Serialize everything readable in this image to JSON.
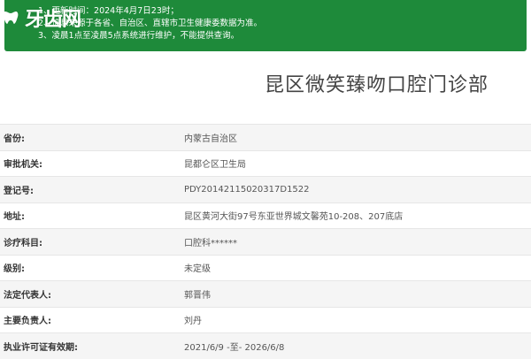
{
  "logo": {
    "text": "牙齿网"
  },
  "notice": {
    "lines": [
      "1、更新时间：2024年4月7日23时；",
      "2、信息来源于各省、自治区、直辖市卫生健康委数据为准。",
      "3、凌晨1点至凌晨5点系统进行维护，不能提供查询。"
    ]
  },
  "title": "昆区微笑臻吻口腔门诊部",
  "rows": [
    {
      "label": "省份:",
      "value": "内蒙古自治区"
    },
    {
      "label": "审批机关:",
      "value": "昆都仑区卫生局"
    },
    {
      "label": "登记号:",
      "value": "PDY20142115020317D1522"
    },
    {
      "label": "地址:",
      "value": "昆区黄河大街97号东亚世界城文馨苑10-208、207底店"
    },
    {
      "label": "诊疗科目:",
      "value": "口腔科******"
    },
    {
      "label": "级别:",
      "value": "未定级"
    },
    {
      "label": "法定代表人:",
      "value": "郭晋伟"
    },
    {
      "label": "主要负责人:",
      "value": "刘丹"
    },
    {
      "label": "执业许可证有效期:",
      "value": "2021/6/9 -至- 2026/6/8"
    }
  ],
  "colors": {
    "notice_bg": "#1e8a3a",
    "row_alt": "#f5f5f5"
  }
}
